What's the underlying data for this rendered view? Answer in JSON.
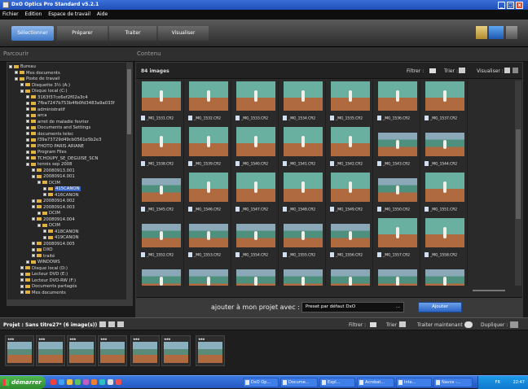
{
  "window": {
    "title": "DxO Optics Pro Standard v5.2.1",
    "minimize": "_",
    "maximize": "□",
    "close": "x"
  },
  "menu": [
    "Fichier",
    "Edition",
    "Espace de travail",
    "Aide"
  ],
  "steps": [
    "Sélectionner",
    "Préparer",
    "Traiter",
    "Visualiser"
  ],
  "headers": {
    "left": "Parcourir",
    "right": "Contenu"
  },
  "tree": [
    {
      "label": "Bureau",
      "indent": 0
    },
    {
      "label": "Mes documents",
      "indent": 1
    },
    {
      "label": "Poste de travail",
      "indent": 1
    },
    {
      "label": "Disquette 3½ (A:)",
      "indent": 2
    },
    {
      "label": "Disque local (C:)",
      "indent": 2
    },
    {
      "label": "3163f37ce6ef2f02a3c4",
      "indent": 3
    },
    {
      "label": "7fba7247b753b4fb0fd3483a9a033f",
      "indent": 3
    },
    {
      "label": "administratif",
      "indent": 3
    },
    {
      "label": "arca",
      "indent": 3
    },
    {
      "label": "arret de maladie fevrier",
      "indent": 3
    },
    {
      "label": "Documents and Settings",
      "indent": 3
    },
    {
      "label": "documents telec",
      "indent": 3
    },
    {
      "label": "f39a73729d49cb0561e5b2e3",
      "indent": 3
    },
    {
      "label": "PHOTO PARIS ARIANE",
      "indent": 3
    },
    {
      "label": "Program Files",
      "indent": 3
    },
    {
      "label": "TCHOUPY_SE_DEGUISE_SCN",
      "indent": 3
    },
    {
      "label": "tennis sep 2008",
      "indent": 3
    },
    {
      "label": "20080913.001",
      "indent": 4
    },
    {
      "label": "20080914.001",
      "indent": 4
    },
    {
      "label": "DCIM",
      "indent": 5
    },
    {
      "label": "415CANON",
      "indent": 6,
      "selected": true
    },
    {
      "label": "416CANON",
      "indent": 6
    },
    {
      "label": "20080914.002",
      "indent": 4
    },
    {
      "label": "20080914.003",
      "indent": 4
    },
    {
      "label": "DCIM",
      "indent": 5
    },
    {
      "label": "20080914.004",
      "indent": 4
    },
    {
      "label": "DCIM",
      "indent": 5
    },
    {
      "label": "418CANON",
      "indent": 6
    },
    {
      "label": "419CANON",
      "indent": 6
    },
    {
      "label": "20080914.005",
      "indent": 4
    },
    {
      "label": "DXO",
      "indent": 4
    },
    {
      "label": "traité",
      "indent": 4
    },
    {
      "label": "WINDOWS",
      "indent": 3
    },
    {
      "label": "Disque local (D:)",
      "indent": 2
    },
    {
      "label": "Lecteur DVD (E:)",
      "indent": 2
    },
    {
      "label": "Lecteur DVD-RW (F:)",
      "indent": 2
    },
    {
      "label": "Documents partagés",
      "indent": 2
    },
    {
      "label": "Mes documents",
      "indent": 2
    }
  ],
  "content": {
    "count": "84 images",
    "filter_label": "Filtrer :",
    "sort_label": "Trier :",
    "view_label": "Visualiser :",
    "images": [
      "_MG_1531.CR2",
      "_MG_1532.CR2",
      "_MG_1533.CR2",
      "_MG_1534.CR2",
      "_MG_1535.CR2",
      "_MG_1536.CR2",
      "_MG_1537.CR2",
      "",
      "_MG_1538.CR2",
      "_MG_1539.CR2",
      "_MG_1540.CR2",
      "_MG_1541.CR2",
      "_MG_1542.CR2",
      "_MG_1543.CR2",
      "_MG_1544.CR2",
      "",
      "_MG_1545.CR2",
      "_MG_1546.CR2",
      "_MG_1547.CR2",
      "_MG_1548.CR2",
      "_MG_1549.CR2",
      "_MG_1550.CR2",
      "_MG_1551.CR2",
      "",
      "_MG_1552.CR2",
      "_MG_1553.CR2",
      "_MG_1554.CR2",
      "_MG_1555.CR2",
      "_MG_1556.CR2",
      "_MG_1557.CR2",
      "_MG_1558.CR2",
      ""
    ],
    "add_label": "ajouter à mon projet avec :",
    "preset": "Preset par défaut DxO",
    "preset_dots": "...",
    "add_button": "Ajouter"
  },
  "project": {
    "title": "Projet : Sans titre27* (6 image(s))",
    "filter_label": "Filtrer :",
    "sort_label": "Trier :",
    "process_label": "Traiter maintenant :",
    "duplicate_label": "Dupliquer :",
    "stars": "★★★"
  },
  "taskbar": {
    "start": "démarrer",
    "tasks": [
      "DxO Op...",
      "Docume...",
      "Expl...",
      "Acrobat...",
      "Inte...",
      "Navos -..."
    ],
    "lang": "FR",
    "time": "22:47"
  },
  "colors": {
    "accent": "#3f78c8",
    "selection": "#3362c9",
    "folder": "#e0b040"
  }
}
